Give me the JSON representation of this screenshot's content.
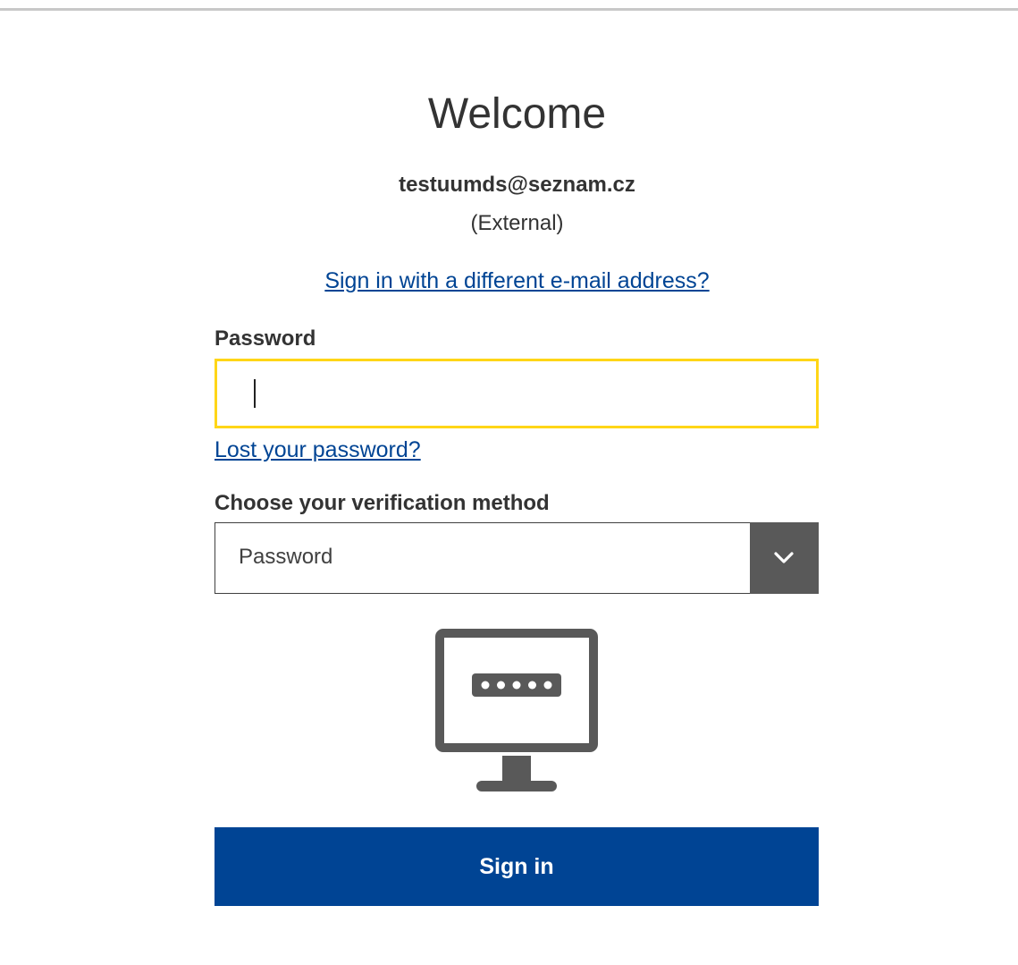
{
  "header": {
    "title": "Welcome",
    "email": "testuumds@seznam.cz",
    "account_type": "(External)",
    "different_email_link": "Sign in with a different e-mail address?"
  },
  "password": {
    "label": "Password",
    "value": "",
    "placeholder": "",
    "lost_link": "Lost your password?"
  },
  "verification": {
    "label": "Choose your verification method",
    "selected": "Password",
    "icon": "monitor-password-icon"
  },
  "actions": {
    "sign_in_label": "Sign in"
  },
  "colors": {
    "primary": "#004494",
    "focus": "#ffd617",
    "select_button": "#595959",
    "icon": "#595959",
    "text": "#333333"
  }
}
